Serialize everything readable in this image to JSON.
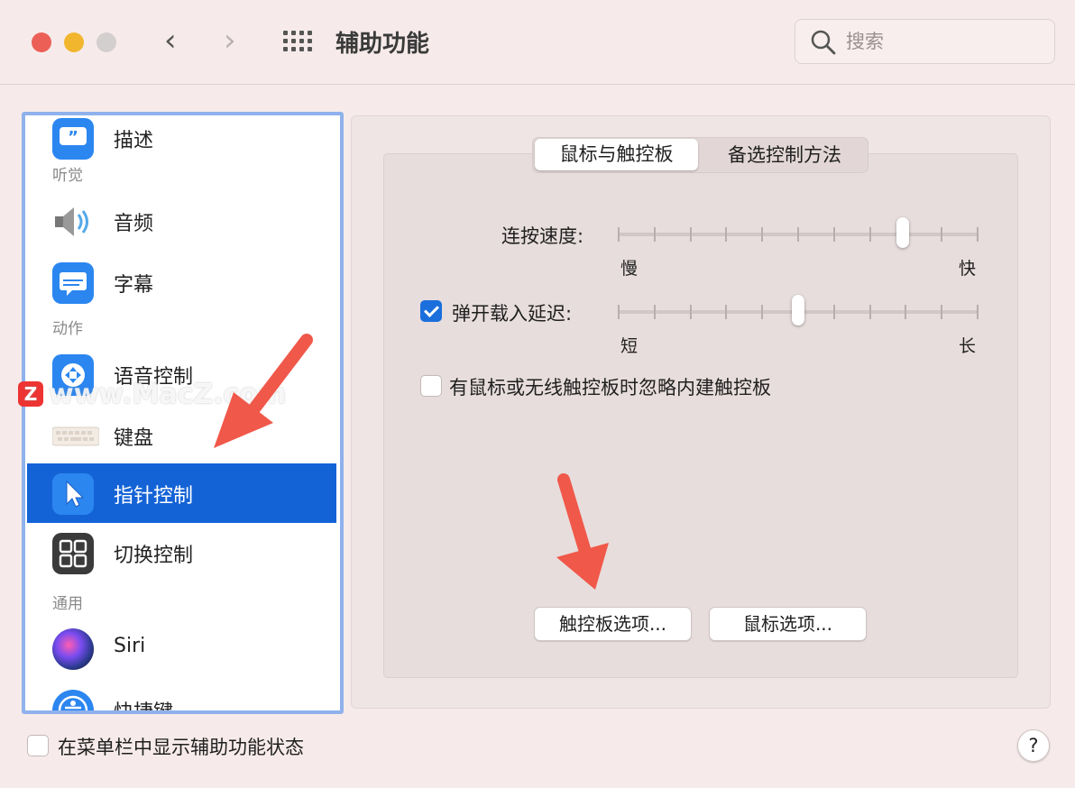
{
  "window": {
    "title": "辅助功能",
    "traffic_lights": {
      "close": "#ec5f57",
      "minimize": "#f2b62e",
      "zoom": "#d4cfcf"
    },
    "nav_back": "‹",
    "nav_forward": "›"
  },
  "search": {
    "placeholder": "搜索",
    "value": ""
  },
  "sidebar": {
    "items": [
      {
        "label": "描述",
        "icon": "quote-bubble-icon",
        "selected": false
      },
      {
        "group": "听觉"
      },
      {
        "label": "音频",
        "icon": "speaker-icon",
        "selected": false
      },
      {
        "label": "字幕",
        "icon": "captions-icon",
        "selected": false
      },
      {
        "group": "动作"
      },
      {
        "label": "语音控制",
        "icon": "voice-control-icon",
        "selected": false
      },
      {
        "label": "键盘",
        "icon": "keyboard-icon",
        "selected": false
      },
      {
        "label": "指针控制",
        "icon": "pointer-icon",
        "selected": true
      },
      {
        "label": "切换控制",
        "icon": "switch-grid-icon",
        "selected": false
      },
      {
        "group": "通用"
      },
      {
        "label": "Siri",
        "icon": "siri-icon",
        "selected": false
      },
      {
        "label": "快捷键",
        "icon": "accessibility-icon",
        "selected": false
      }
    ],
    "selected_color": "#1463d6"
  },
  "tabs": [
    {
      "label": "鼠标与触控板",
      "active": true
    },
    {
      "label": "备选控制方法",
      "active": false
    }
  ],
  "settings": {
    "double_click_speed": {
      "label": "连按速度:",
      "min_label": "慢",
      "max_label": "快",
      "value_fraction": 0.79,
      "ticks": 11
    },
    "spring_loading": {
      "label": "弹开载入延迟:",
      "checked": true,
      "min_label": "短",
      "max_label": "长",
      "value_fraction": 0.5,
      "ticks": 11
    },
    "ignore_trackpad": {
      "label": "有鼠标或无线触控板时忽略内建触控板",
      "checked": false
    }
  },
  "buttons": {
    "trackpad_options": "触控板选项...",
    "mouse_options": "鼠标选项..."
  },
  "footer": {
    "show_status_label": "在菜单栏中显示辅助功能状态",
    "show_status_checked": false,
    "help": "?"
  },
  "watermark": {
    "badge": "Z",
    "text": "www.MacZ.com"
  },
  "accent_color": "#1b6fdc",
  "annotation_arrow_color": "#f0584a"
}
